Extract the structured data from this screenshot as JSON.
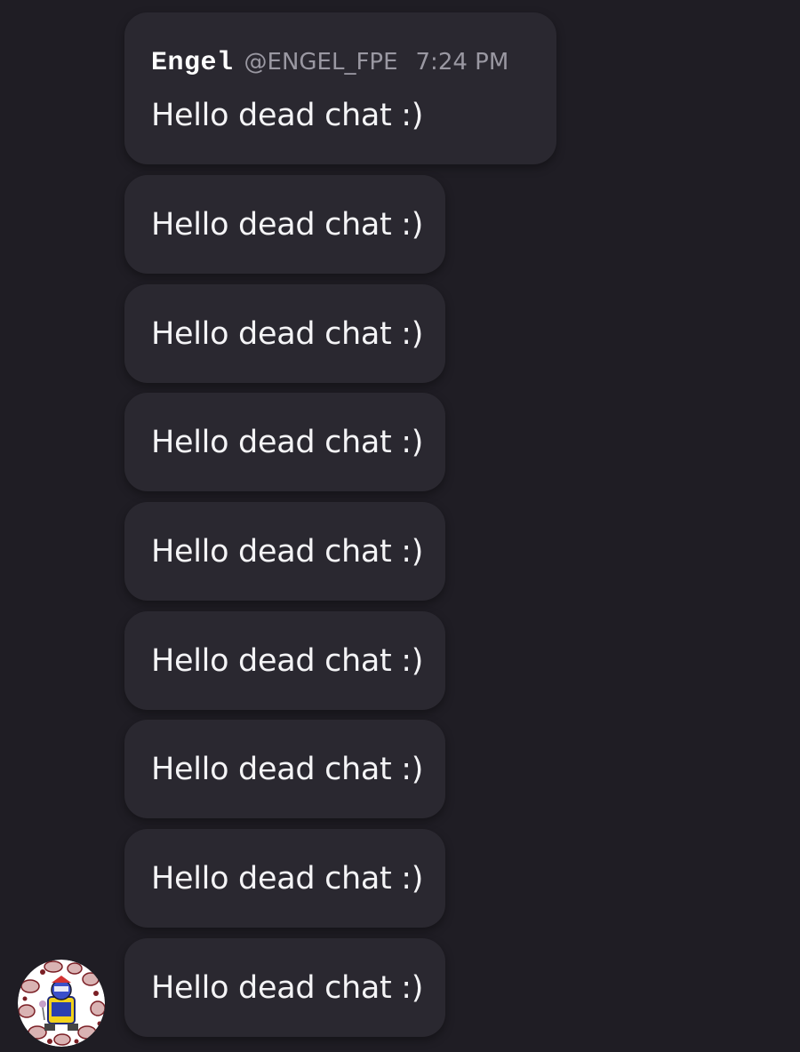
{
  "message_group": {
    "author_name": "Engel",
    "author_handle": "@ENGEL_FPE",
    "timestamp": "7:24 PM",
    "messages": [
      {
        "text": "Hello dead chat :)"
      },
      {
        "text": "Hello dead chat :)"
      },
      {
        "text": "Hello dead chat :)"
      },
      {
        "text": "Hello dead chat :)"
      },
      {
        "text": "Hello dead chat :)"
      },
      {
        "text": "Hello dead chat :)"
      },
      {
        "text": "Hello dead chat :)"
      },
      {
        "text": "Hello dead chat :)"
      },
      {
        "text": "Hello dead chat :)"
      }
    ]
  },
  "avatar": {
    "icon": "user-avatar-icon"
  },
  "colors": {
    "background": "#1f1d24",
    "bubble": "#2a2830",
    "text": "#f4f4f6",
    "muted": "#9a98a2"
  }
}
